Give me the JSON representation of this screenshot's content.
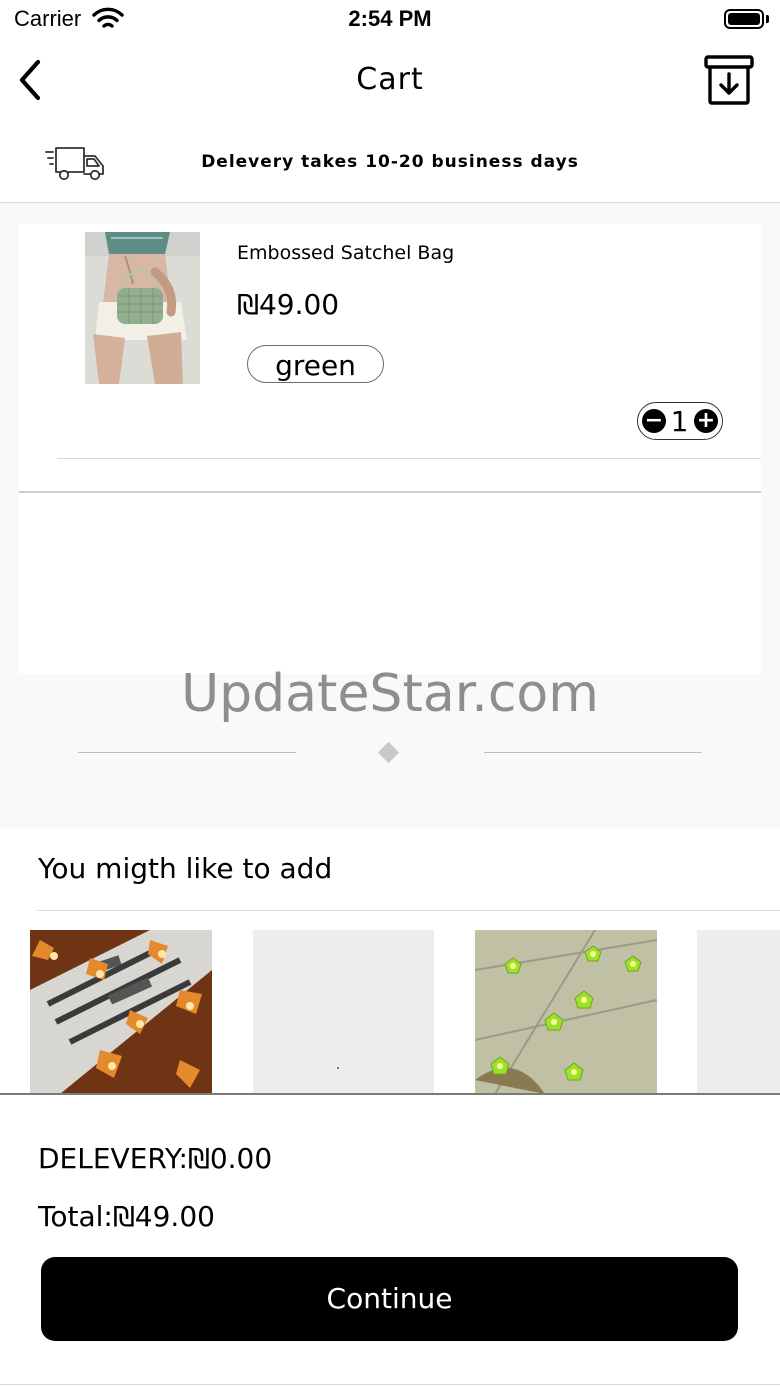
{
  "status_bar": {
    "carrier": "Carrier",
    "time": "2:54 PM"
  },
  "header": {
    "title": "Cart",
    "back_icon": "chevron-left-icon",
    "action_icon": "archive-download-icon"
  },
  "delivery_banner": {
    "icon": "delivery-truck-icon",
    "text": "Delevery takes 10-20 business days"
  },
  "cart": {
    "items": [
      {
        "name": "Embossed Satchel Bag",
        "price": "₪49.00",
        "variant": "green",
        "quantity": "1"
      }
    ]
  },
  "watermark": {
    "text": "UpdateStar.com"
  },
  "suggestions": {
    "title": "You migth like to add",
    "items": [
      {
        "image": "maple-leaf-string-lights"
      },
      {
        "image": "placeholder"
      },
      {
        "image": "green-flower-string-lights"
      },
      {
        "image": "placeholder"
      }
    ]
  },
  "totals": {
    "delivery": "DELEVERY:₪0.00",
    "total": "Total:₪49.00",
    "continue_label": "Continue"
  },
  "colors": {
    "primary": "#000000",
    "background": "#f9f9f9",
    "card": "#ffffff"
  }
}
